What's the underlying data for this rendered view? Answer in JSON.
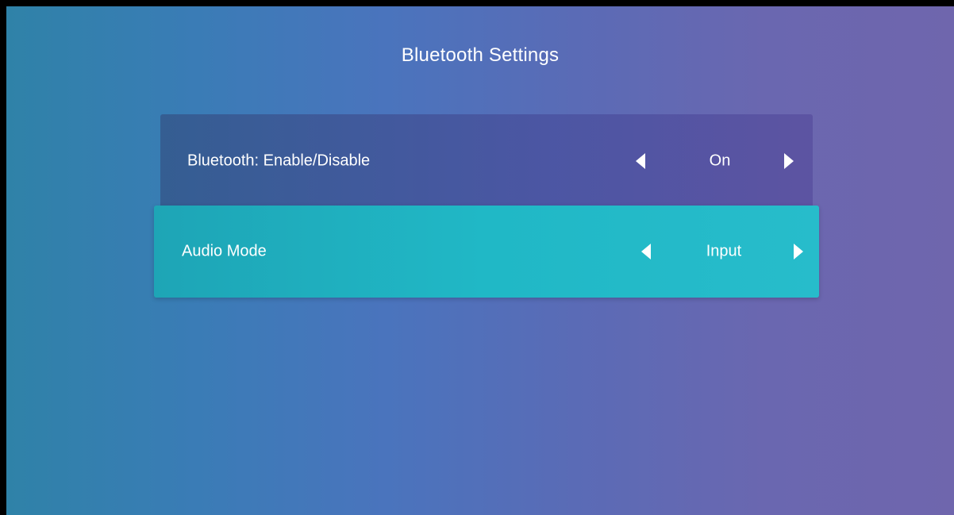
{
  "header": {
    "title": "Bluetooth Settings"
  },
  "settings": {
    "items": [
      {
        "label": "Bluetooth: Enable/Disable",
        "value": "On",
        "left_icon": "triangle-left-icon",
        "right_icon": "triangle-right-icon"
      },
      {
        "label": "Audio Mode",
        "value": "Input",
        "left_icon": "triangle-left-icon",
        "right_icon": "triangle-right-icon",
        "selected": true
      }
    ]
  },
  "colors": {
    "selected_row": "#20b8c6",
    "text": "#ffffff",
    "bg_start": "#2f82a8",
    "bg_end": "#6f66ad"
  }
}
